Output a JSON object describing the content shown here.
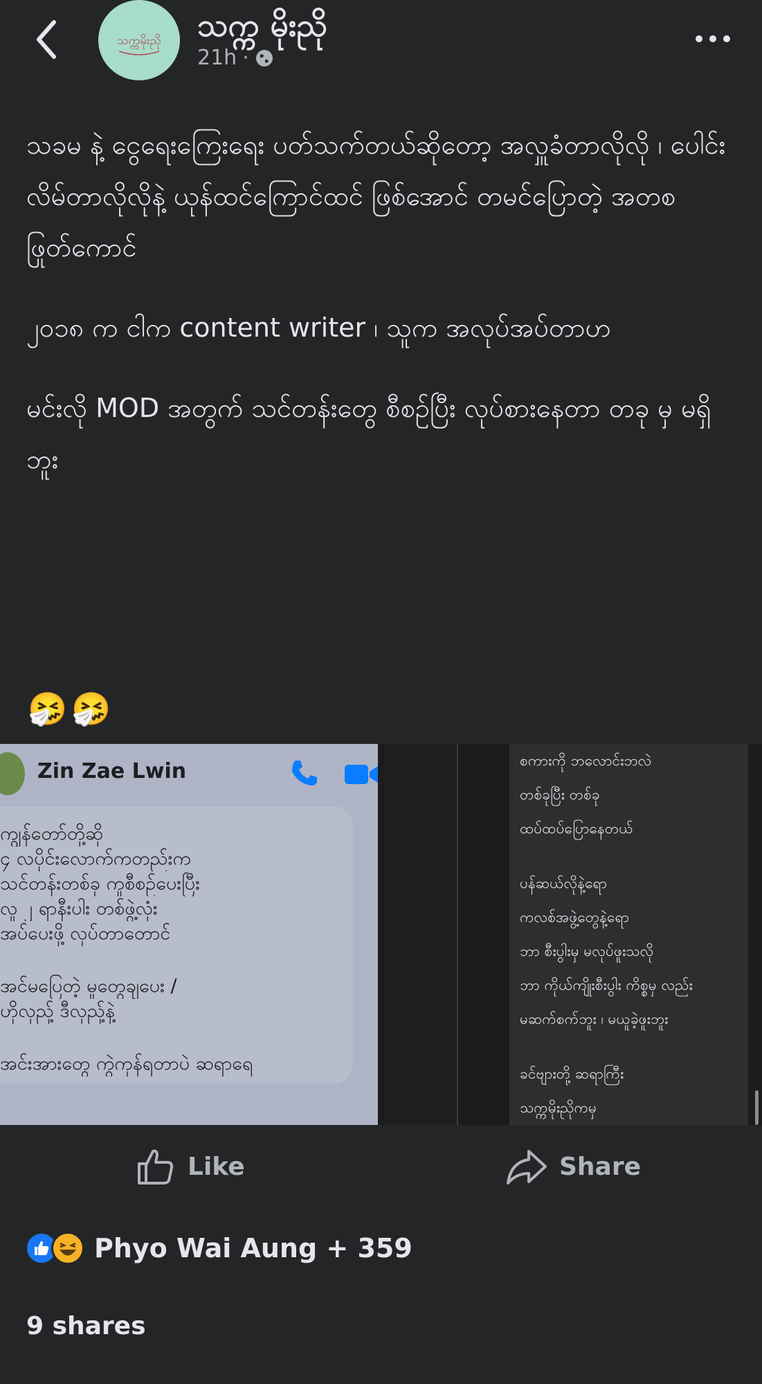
{
  "header": {
    "page_name": "သက္က မိုးညို",
    "time": "21h",
    "separator": "·",
    "avatar_text": "သက္ကမိုးညို"
  },
  "post": {
    "paragraphs": [
      "သခမ နဲ့ ငွေရေးကြေးရေး ပတ်သက်တယ်ဆိုတော့ အလှူခံတာလိုလို ၊ ပေါင်းလိမ်တာလိုလိုနဲ့ ယုန်ထင်ကြောင်ထင် ဖြစ်အောင် တမင်ပြောတဲ့ အတစ ဖြုတ်ကောင်",
      "၂၀၁၈ က ငါက content writer ၊ သူက အလုပ်အပ်တာဟ",
      "မင်းလို MOD အတွက် သင်တန်းတွေ စီစဉ်ပြီး လုပ်စားနေတာ တခု မှ မရှိဘူး"
    ],
    "emoji": [
      "🤧",
      "🤧"
    ]
  },
  "media": {
    "chat": {
      "contact_name": "Zin Zae Lwin",
      "lines": [
        "ကျွန်တော်တို့ဆို",
        "၄ လပိုင်းလောက်ကတည်းက",
        "သင်တန်းတစ်ခု ကူစီစဉ်ပေးပြီး",
        "လူ ၂ ရာနီးပါး တစ်ဖွဲ့လုံး",
        "အပ်ပေးဖို့ လုပ်တာတောင်",
        "",
        "အင်မပြေတဲ့ မှုတွေချပေး /",
        "ဟိုလုညှ့် ဒီလုညှ့်နဲ့",
        "",
        "အင်းအားတွေ ကွဲကုန်ရတာပဲ ဆရာရေ"
      ]
    },
    "right_text": [
      "စကားကို ဘလောင်းဘလဲ",
      "တစ်ခုပြီး တစ်ခု",
      "ထပ်ထပ်ပြောနေတယ်",
      "",
      "ပန်ဆယ်လိုနဲ့ရော",
      "ကလစ်အဖွဲ့တွေနဲ့ရော",
      "ဘာ စီးပွါးမှ မလုပ်ဖူးသလို",
      "ဘာ ကိုယ်ကျိုးစီးပွါး ကိစ္စမှ လည်း",
      "မဆက်စက်ဘူး ၊ မယူခဲ့ဖူးဘူး",
      "",
      "ခင်ဗျားတို့ ဆရာကြီး",
      "သက္ကမိုးညိုကမှ"
    ]
  },
  "actions": {
    "like_label": "Like",
    "share_label": "Share"
  },
  "reactions": {
    "text": "Phyo Wai Aung + 359"
  },
  "shares": {
    "text": "9 shares"
  },
  "colors": {
    "background": "#242526",
    "text_primary": "#e4e6eb",
    "text_secondary": "#b0b3b8",
    "like_blue": "#1877f2",
    "avatar_mint": "#a8dccb",
    "messenger_blue": "#0a7cff"
  },
  "icons": {
    "back": "chevron-left-icon",
    "more": "more-dots-icon",
    "privacy": "globe-icon",
    "like": "thumbs-up-icon",
    "share": "share-arrow-icon",
    "call": "phone-icon",
    "video": "video-camera-icon"
  }
}
